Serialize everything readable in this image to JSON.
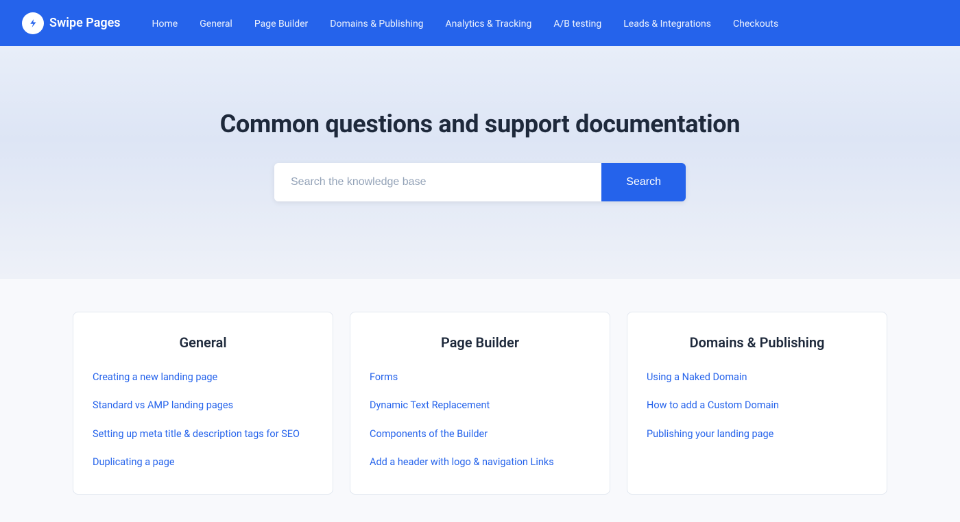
{
  "brand": {
    "name": "Swipe Pages"
  },
  "nav": {
    "links": [
      {
        "label": "Home",
        "id": "nav-home"
      },
      {
        "label": "General",
        "id": "nav-general"
      },
      {
        "label": "Page Builder",
        "id": "nav-page-builder"
      },
      {
        "label": "Domains & Publishing",
        "id": "nav-domains"
      },
      {
        "label": "Analytics & Tracking",
        "id": "nav-analytics"
      },
      {
        "label": "A/B testing",
        "id": "nav-ab-testing"
      },
      {
        "label": "Leads & Integrations",
        "id": "nav-leads"
      },
      {
        "label": "Checkouts",
        "id": "nav-checkouts"
      }
    ]
  },
  "hero": {
    "title": "Common questions and support documentation",
    "search_placeholder": "Search the knowledge base",
    "search_button": "Search"
  },
  "cards": [
    {
      "id": "general",
      "title": "General",
      "links": [
        "Creating a new landing page",
        "Standard vs AMP landing pages",
        "Setting up meta title & description tags for SEO",
        "Duplicating a page"
      ]
    },
    {
      "id": "page-builder",
      "title": "Page Builder",
      "links": [
        "Forms",
        "Dynamic Text Replacement",
        "Components of the Builder",
        "Add a header with logo & navigation Links"
      ]
    },
    {
      "id": "domains-publishing",
      "title": "Domains & Publishing",
      "links": [
        "Using a Naked Domain",
        "How to add a Custom Domain",
        "Publishing your landing page"
      ]
    }
  ]
}
